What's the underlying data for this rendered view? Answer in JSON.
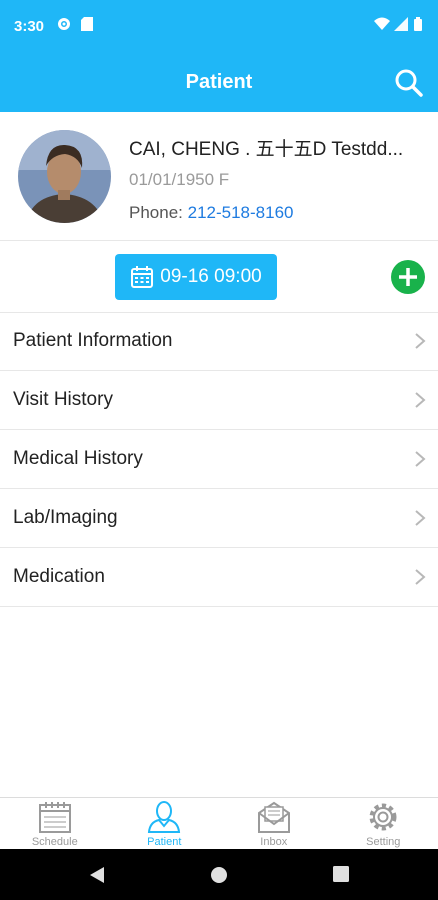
{
  "status_bar": {
    "time": "3:30"
  },
  "header": {
    "title": "Patient"
  },
  "patient": {
    "name": "CAI, CHENG . 五十五D Testdd...",
    "dob_gender": "01/01/1950 F",
    "phone_label": "Phone: ",
    "phone": "212-518-8160"
  },
  "appointment": {
    "datetime": "09-16 09:00"
  },
  "menu": [
    {
      "label": "Patient Information"
    },
    {
      "label": "Visit History"
    },
    {
      "label": "Medical History"
    },
    {
      "label": "Lab/Imaging"
    },
    {
      "label": "Medication"
    }
  ],
  "tabs": [
    {
      "label": "Schedule",
      "icon": "calendar-icon",
      "active": false
    },
    {
      "label": "Patient",
      "icon": "person-icon",
      "active": true
    },
    {
      "label": "Inbox",
      "icon": "envelope-icon",
      "active": false
    },
    {
      "label": "Setting",
      "icon": "gear-icon",
      "active": false
    }
  ],
  "colors": {
    "primary": "#1fb7f7",
    "add_button": "#19b24b",
    "link": "#1e7be0"
  }
}
